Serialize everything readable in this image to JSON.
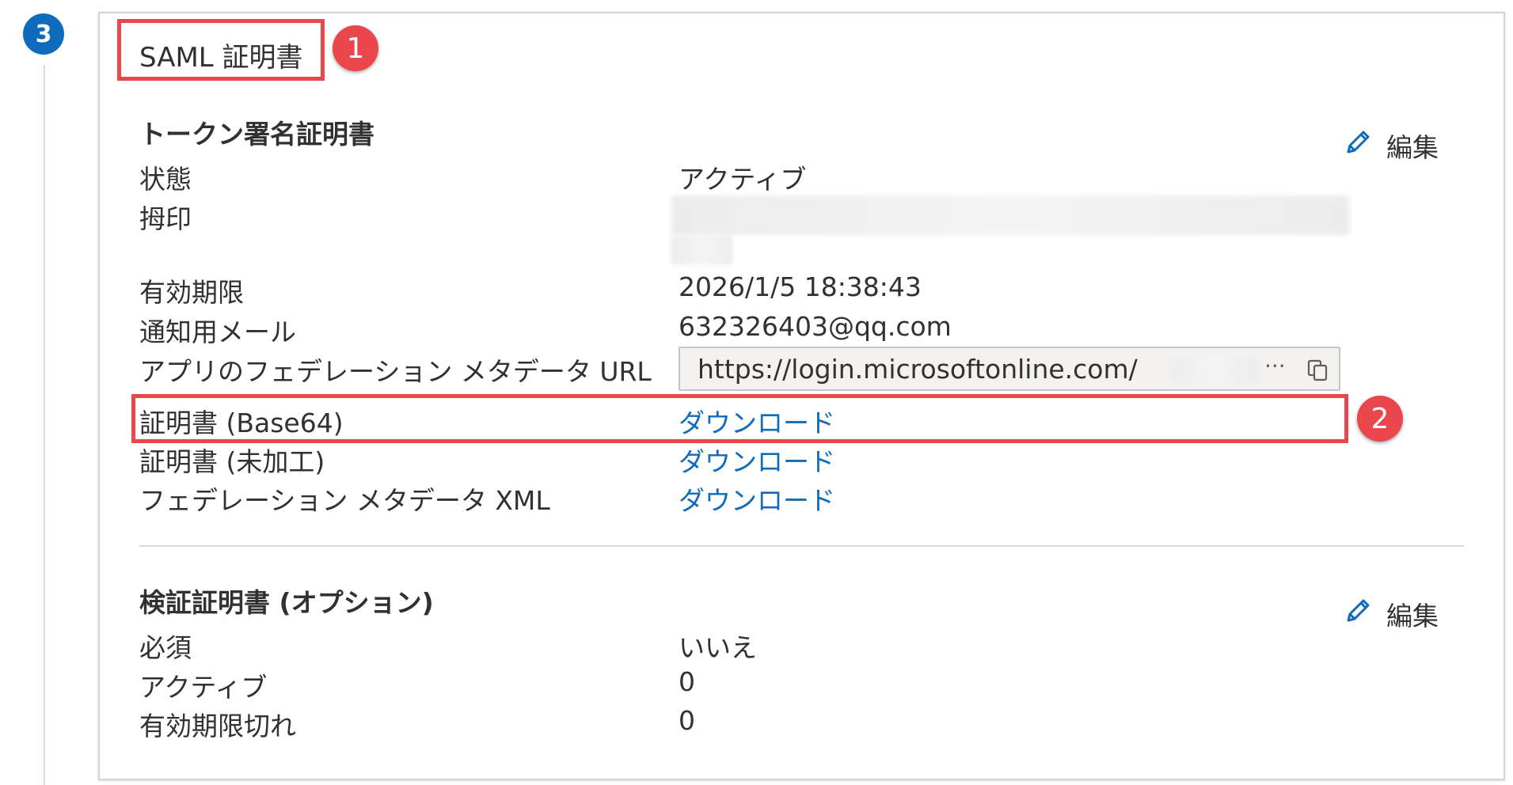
{
  "step": {
    "number": "3"
  },
  "annotations": {
    "marker1": "1",
    "marker2": "2"
  },
  "card": {
    "title": "SAML 証明書"
  },
  "token_signing": {
    "title": "トークン署名証明書",
    "edit_label": "編集",
    "rows": {
      "status": {
        "label": "状態",
        "value": "アクティブ"
      },
      "thumbprint": {
        "label": "拇印"
      },
      "expiration": {
        "label": "有効期限",
        "value": "2026/1/5 18:38:43"
      },
      "notification_email": {
        "label": "通知用メール",
        "value": "632326403@qq.com"
      },
      "metadata_url": {
        "label": "アプリのフェデレーション メタデータ URL",
        "value": "https://login.microsoftonline.com/",
        "ellipsis": "···"
      },
      "cert_base64": {
        "label": "証明書 (Base64)",
        "link": "ダウンロード"
      },
      "cert_raw": {
        "label": "証明書 (未加工)",
        "link": "ダウンロード"
      },
      "federation_xml": {
        "label": "フェデレーション メタデータ XML",
        "link": "ダウンロード"
      }
    }
  },
  "verification": {
    "title": "検証証明書 (オプション)",
    "edit_label": "編集",
    "rows": {
      "required": {
        "label": "必須",
        "value": "いいえ"
      },
      "active": {
        "label": "アクティブ",
        "value": "0"
      },
      "expired": {
        "label": "有効期限切れ",
        "value": "0"
      }
    }
  },
  "colors": {
    "accent": "#0f6cbd",
    "annotation": "#e9474c",
    "text": "#323130"
  },
  "icons": {
    "edit": "pencil-icon",
    "copy": "copy-icon"
  }
}
